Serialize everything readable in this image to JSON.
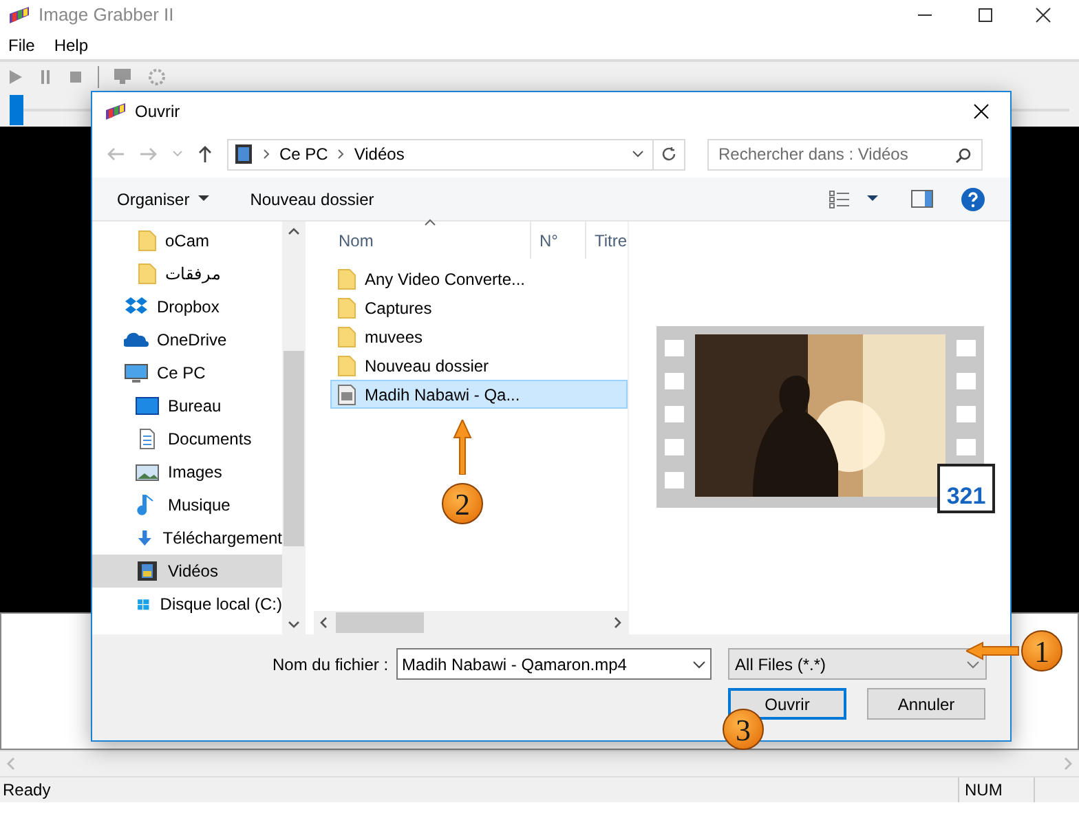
{
  "window": {
    "title": "Image Grabber II"
  },
  "menu": [
    "File",
    "Help"
  ],
  "toolbar": {
    "slider": {
      "level": 0.0
    }
  },
  "status_bar": {
    "text": "Ready",
    "num": "NUM"
  },
  "dialog": {
    "title": "Ouvrir",
    "breadcrumb": [
      "Ce PC",
      "Vidéos"
    ],
    "search": {
      "placeholder": "Rechercher dans : Vidéos"
    },
    "toolbar": [
      "Organiser",
      "Nouveau dossier"
    ],
    "sidebar": {
      "items": [
        {
          "label": "oCam",
          "kind": "folder",
          "selected": false
        },
        {
          "label": "مرفقات",
          "kind": "folder",
          "selected": false
        },
        {
          "label": "Dropbox",
          "kind": "dropbox",
          "selected": false
        },
        {
          "label": "OneDrive",
          "kind": "onedrive",
          "selected": false
        },
        {
          "label": "Ce PC",
          "kind": "pc",
          "selected": false,
          "children": [
            {
              "label": "Bureau",
              "kind": "desktop",
              "selected": false
            },
            {
              "label": "Documents",
              "kind": "documents",
              "selected": false
            },
            {
              "label": "Images",
              "kind": "images",
              "selected": false
            },
            {
              "label": "Musique",
              "kind": "music",
              "selected": false
            },
            {
              "label": "Téléchargement",
              "kind": "download",
              "selected": false
            },
            {
              "label": "Vidéos",
              "kind": "videos",
              "selected": true
            },
            {
              "label": "Disque local (C:)",
              "kind": "drive",
              "selected": false
            }
          ]
        }
      ]
    },
    "columns": [
      "Nom",
      "N°",
      "Titre"
    ],
    "files": [
      {
        "name": "Any Video Converte...",
        "kind": "folder",
        "selected": false
      },
      {
        "name": "Captures",
        "kind": "folder",
        "selected": false
      },
      {
        "name": "muvees",
        "kind": "folder",
        "selected": false
      },
      {
        "name": "Nouveau dossier",
        "kind": "folder",
        "selected": false
      },
      {
        "name": "Madih Nabawi - Qa...",
        "kind": "video",
        "selected": true
      }
    ],
    "preview": {
      "kind": "picture",
      "badge": "321"
    },
    "filename_label": "Nom du fichier :",
    "filename": "Madih Nabawi - Qamaron.mp4",
    "filter": "All Files (*.*)",
    "buttons": [
      "Ouvrir",
      "Annuler"
    ]
  },
  "annotations": [
    "1",
    "2",
    "3"
  ]
}
